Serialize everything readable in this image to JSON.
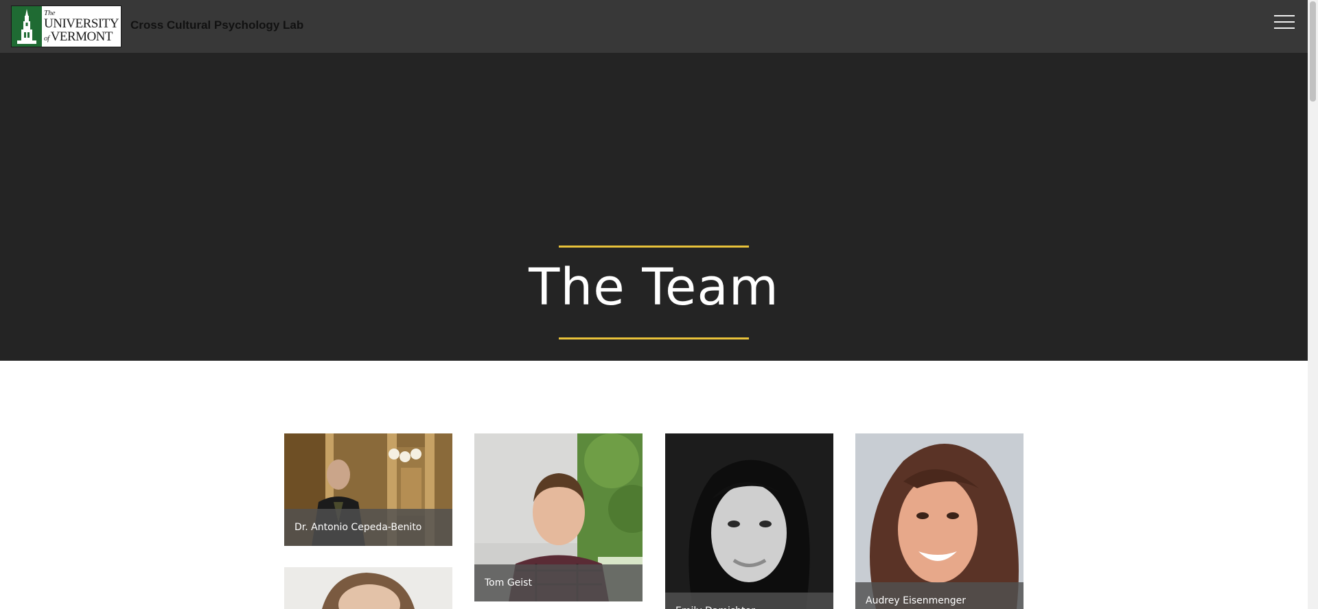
{
  "header": {
    "logo": {
      "line1": "The",
      "line2": "UNIVERSITY",
      "line3_prefix": "of",
      "line3": "VERMONT"
    },
    "site_title": "Cross Cultural Psychology Lab",
    "menu_icon": "hamburger-menu-icon"
  },
  "hero": {
    "title": "The Team",
    "accent_color": "#e8c23a",
    "background_color": "#242424"
  },
  "team": [
    {
      "name": "Dr. Antonio Cepeda-Benito"
    },
    {
      "name": "Tom Geist"
    },
    {
      "name": "Emily Damishter"
    },
    {
      "name": "Audrey Eisenmenger"
    },
    {
      "name": ""
    }
  ],
  "colors": {
    "header_bg": "#383838",
    "uvm_green": "#1f6b33",
    "caption_bg": "#505050"
  }
}
